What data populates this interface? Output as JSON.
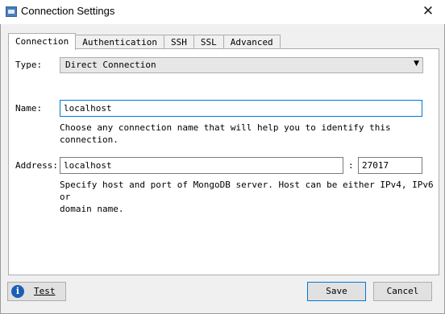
{
  "window": {
    "title": "Connection Settings",
    "close_glyph": "✕"
  },
  "tabs": [
    {
      "label": "Connection",
      "active": true
    },
    {
      "label": "Authentication",
      "active": false
    },
    {
      "label": "SSH",
      "active": false
    },
    {
      "label": "SSL",
      "active": false
    },
    {
      "label": "Advanced",
      "active": false
    }
  ],
  "form": {
    "type_label": "Type:",
    "type_value": "Direct Connection",
    "name_label": "Name:",
    "name_value": "localhost",
    "name_hint": "Choose any connection name that will help you to identify this connection.",
    "address_label": "Address:",
    "host_value": "localhost",
    "separator": ":",
    "port_value": "27017",
    "address_hint_line1": "Specify host and port of MongoDB server. Host can be either IPv4, IPv6 or",
    "address_hint_line2": "domain name."
  },
  "buttons": {
    "test_label": "Test",
    "test_icon": "info-icon",
    "save_label": "Save",
    "cancel_label": "Cancel"
  },
  "icons": {
    "app": "window-icon",
    "close": "close-icon",
    "dropdown": "chevron-down-icon"
  },
  "colors": {
    "focus_border": "#0078d7",
    "info_icon": "#1a5fb4"
  }
}
